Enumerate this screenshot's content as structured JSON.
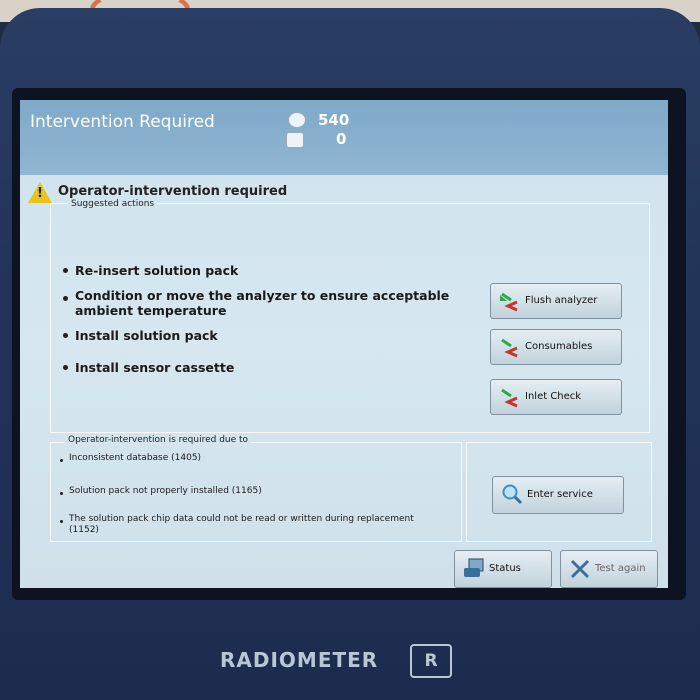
{
  "header": {
    "title": "Intervention Required",
    "counter_top": "540",
    "counter_bottom": "0"
  },
  "alert": {
    "icon": "warning-icon",
    "heading": "Operator-intervention required"
  },
  "suggested": {
    "legend": "Suggested actions",
    "items": [
      {
        "label": "Re-insert solution pack"
      },
      {
        "label": "Condition or move the analyzer to ensure acceptable ambient temperature"
      },
      {
        "label": "Install solution pack"
      },
      {
        "label": "Install sensor cassette"
      }
    ]
  },
  "action_buttons": [
    {
      "label": "Flush analyzer",
      "icon": "action-arrows-icon"
    },
    {
      "label": "Consumables",
      "icon": "action-arrows-icon"
    },
    {
      "label": "Inlet Check",
      "icon": "action-arrows-icon"
    }
  ],
  "reasons": {
    "legend": "Operator-intervention is required due to",
    "items": [
      {
        "label": "Inconsistent database (1405)"
      },
      {
        "label": "Solution pack not properly installed (1165)"
      },
      {
        "label": "The solution pack chip data could not be read or written during replacement (1152)"
      }
    ]
  },
  "service_button": {
    "label": "Enter service",
    "icon": "magnifier-icon"
  },
  "footer_buttons": {
    "status": {
      "label": "Status",
      "icon": "status-icon"
    },
    "test_again": {
      "label": "Test again",
      "icon": "x-icon"
    }
  },
  "brand": {
    "name": "RADIOMETER",
    "mark": "R"
  },
  "colors": {
    "titlebar": "#8fb6d2",
    "screen": "#d6e7ef",
    "bezel": "#22345a",
    "warning": "#e7c320",
    "arrow_green": "#2fa84a",
    "arrow_red": "#c0392b"
  }
}
